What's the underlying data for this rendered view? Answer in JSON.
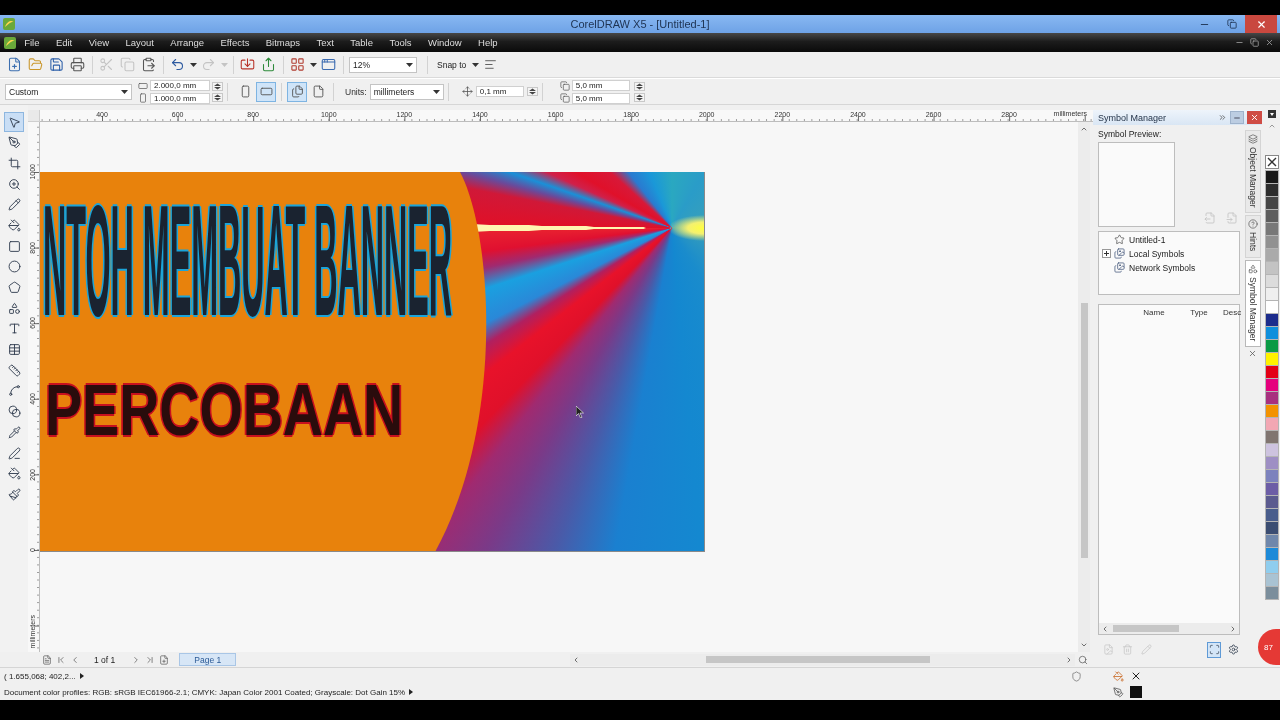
{
  "window": {
    "title": "CorelDRAW X5 - [Untitled-1]"
  },
  "menu": [
    "File",
    "Edit",
    "View",
    "Layout",
    "Arrange",
    "Effects",
    "Bitmaps",
    "Text",
    "Table",
    "Tools",
    "Window",
    "Help"
  ],
  "toolbar": {
    "buttons": [
      {
        "disabled": false,
        "caret": false
      },
      {
        "disabled": false,
        "caret": false
      },
      {
        "disabled": false,
        "caret": false
      },
      {
        "disabled": false,
        "caret": false
      },
      {
        "disabled": true,
        "caret": false
      },
      {
        "disabled": true,
        "caret": false
      },
      {
        "disabled": false,
        "caret": false
      },
      {
        "disabled": false,
        "caret": true
      },
      {
        "disabled": true,
        "caret": true
      },
      {
        "disabled": false,
        "caret": false
      },
      {
        "disabled": false,
        "caret": false
      },
      {
        "disabled": false,
        "caret": true
      },
      {
        "disabled": false,
        "caret": false
      }
    ],
    "zoom": "12%",
    "snap_label": "Snap to"
  },
  "property_bar": {
    "preset": "Custom",
    "width": "2.000,0 mm",
    "height": "1.000,0 mm",
    "orientation": [
      {
        "selected": false
      },
      {
        "selected": true
      }
    ],
    "page_scope": [
      {
        "selected": true
      },
      {
        "selected": false
      }
    ],
    "units_label": "Units:",
    "units": "millimeters",
    "nudge": "0,1 mm",
    "duplicate_x": "5,0 mm",
    "duplicate_y": "5,0 mm"
  },
  "toolbox": [
    {
      "selected": true
    },
    {
      "selected": false
    },
    {
      "selected": false
    },
    {
      "selected": false
    },
    {
      "selected": false
    },
    {
      "selected": false
    },
    {
      "selected": false
    },
    {
      "selected": false
    },
    {
      "selected": false
    },
    {
      "selected": false
    },
    {
      "selected": false
    },
    {
      "selected": false
    },
    {
      "selected": false
    },
    {
      "selected": false
    },
    {
      "selected": false
    },
    {
      "selected": false
    },
    {
      "selected": false
    },
    {
      "selected": false
    },
    {
      "selected": false
    }
  ],
  "rulers": {
    "horizontal": [
      "400",
      "600",
      "800",
      "1000",
      "1200",
      "1400",
      "1600",
      "1800",
      "2000",
      "2200",
      "2400",
      "2600",
      "2800"
    ],
    "horizontal_unit": "millimeters",
    "vertical": [
      "1000",
      "800",
      "600",
      "400",
      "200",
      "0"
    ],
    "vertical_unit": "millimeters"
  },
  "banner": {
    "headline": "NTOH MEMBUAT BANNER",
    "subtitle": "PERCOBAAN"
  },
  "page_nav": {
    "counter": "1 of 1",
    "tabs": [
      {
        "label": "Page 1",
        "selected": true
      }
    ]
  },
  "docker": {
    "title": "Symbol Manager",
    "preview_label": "Symbol Preview:",
    "preview_buttons": [
      {
        "disabled": true
      },
      {
        "disabled": true
      }
    ],
    "tree": [
      {
        "label": "Untitled-1"
      },
      {
        "label": "Local Symbols",
        "expanded": false
      },
      {
        "label": "Network Symbols"
      }
    ],
    "columns": [
      "Name",
      "Type",
      "Desc"
    ],
    "footer_buttons": [
      {
        "disabled": true,
        "selected": false
      },
      {
        "disabled": true,
        "selected": false
      },
      {
        "disabled": true,
        "selected": false
      },
      {
        "disabled": false,
        "selected": true
      },
      {
        "disabled": false,
        "selected": false
      }
    ],
    "tabs": [
      {
        "label": "Object Manager",
        "selected": false
      },
      {
        "label": "Hints",
        "selected": false
      },
      {
        "label": "Symbol Manager",
        "selected": true
      }
    ]
  },
  "palette": [
    {
      "color": "#181818"
    },
    {
      "color": "#2d2d2d"
    },
    {
      "color": "#464646"
    },
    {
      "color": "#5e5e5e"
    },
    {
      "color": "#787878"
    },
    {
      "color": "#919191"
    },
    {
      "color": "#aaaaaa"
    },
    {
      "color": "#c3c3c3"
    },
    {
      "color": "#dcdcdc"
    },
    {
      "color": "#efefef"
    },
    {
      "color": "#ffffff"
    },
    {
      "color": "#1c2c8c"
    },
    {
      "color": "#0f8fdc"
    },
    {
      "color": "#0a9a44"
    },
    {
      "color": "#fff200"
    },
    {
      "color": "#e30016"
    },
    {
      "color": "#e5007d"
    },
    {
      "color": "#a8307f"
    },
    {
      "color": "#f39200"
    },
    {
      "color": "#f2a7b3"
    },
    {
      "color": "#807570"
    },
    {
      "color": "#cdc3df"
    },
    {
      "color": "#9e8fc4"
    },
    {
      "color": "#7c82bd"
    },
    {
      "color": "#6c5da6"
    },
    {
      "color": "#5b5b8f"
    },
    {
      "color": "#495d8c"
    },
    {
      "color": "#3b4d72"
    },
    {
      "color": "#6f87ab"
    },
    {
      "color": "#1d8ad8"
    },
    {
      "color": "#8fcdee"
    },
    {
      "color": "#a9c3d3"
    },
    {
      "color": "#7b8e9c"
    }
  ],
  "status_bar": {
    "coordinates": "( 1.655,068; 402,2...",
    "color_profiles": "Document color profiles: RGB: sRGB IEC61966-2.1; CMYK: Japan Color 2001 Coated; Grayscale: Dot Gain 15%"
  },
  "recording_badge": "87"
}
